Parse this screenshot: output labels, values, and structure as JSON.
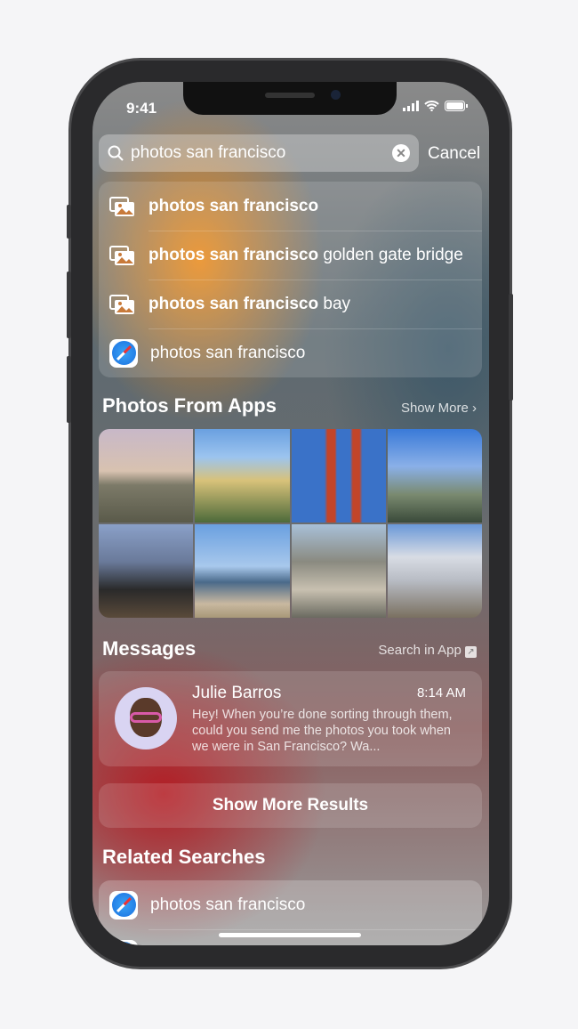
{
  "status": {
    "time": "9:41"
  },
  "search": {
    "query": "photos san francisco",
    "cancel": "Cancel"
  },
  "suggestions": [
    {
      "icon": "photos-icon",
      "bold": "photos san francisco",
      "rest": ""
    },
    {
      "icon": "photos-icon",
      "bold": "photos san francisco",
      "rest": " golden gate bridge"
    },
    {
      "icon": "photos-icon",
      "bold": "photos san francisco",
      "rest": " bay"
    },
    {
      "icon": "safari-icon",
      "bold": "",
      "rest": "photos san francisco"
    }
  ],
  "photos_section": {
    "title": "Photos From Apps",
    "link": "Show More"
  },
  "messages_section": {
    "title": "Messages",
    "link": "Search in App",
    "message": {
      "sender": "Julie Barros",
      "time": "8:14 AM",
      "body": "Hey! When you’re done sorting through them, could you send me the photos you took when we were in San Francisco? Wa..."
    }
  },
  "show_more": "Show More Results",
  "related": {
    "title": "Related Searches",
    "items": [
      "photos san francisco"
    ]
  }
}
